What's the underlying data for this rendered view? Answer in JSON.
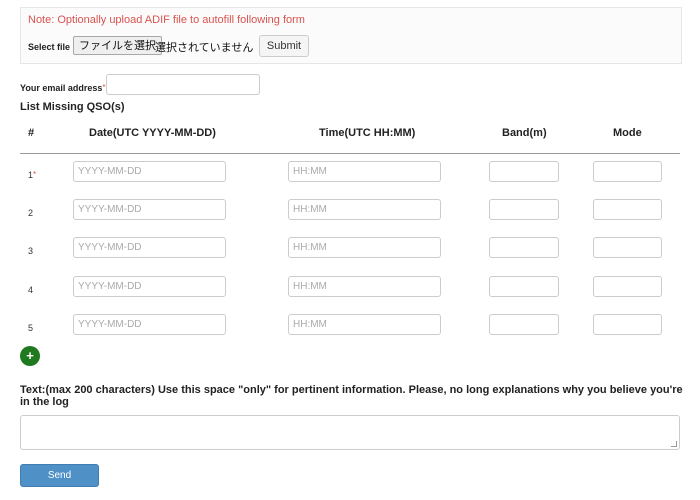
{
  "upload": {
    "note": "Note: Optionally upload ADIF file to autofill following form",
    "select_label": "Select file",
    "file_button": "ファイルを選択",
    "file_status": "選択されていません",
    "submit_label": "Submit"
  },
  "email": {
    "label": "Your email address",
    "required_mark": "*",
    "value": ""
  },
  "qso": {
    "title": "List Missing QSO(s)",
    "headers": {
      "num": "#",
      "date": "Date(UTC YYYY-MM-DD)",
      "time": "Time(UTC HH:MM)",
      "band": "Band(m)",
      "mode": "Mode"
    },
    "rows": [
      {
        "num": "1",
        "required_mark": "*",
        "date_placeholder": "YYYY-MM-DD",
        "time_placeholder": "HH:MM"
      },
      {
        "num": "2",
        "date_placeholder": "YYYY-MM-DD",
        "time_placeholder": "HH:MM"
      },
      {
        "num": "3",
        "date_placeholder": "YYYY-MM-DD",
        "time_placeholder": "HH:MM"
      },
      {
        "num": "4",
        "date_placeholder": "YYYY-MM-DD",
        "time_placeholder": "HH:MM"
      },
      {
        "num": "5",
        "date_placeholder": "YYYY-MM-DD",
        "time_placeholder": "HH:MM"
      }
    ],
    "add_label": "+"
  },
  "text": {
    "label": "Text:(max 200 characters) Use this space \"only\" for pertinent information. Please, no long explanations why you believe you're in the log",
    "value": ""
  },
  "send_label": "Send",
  "colors": {
    "note_red": "#d9534f",
    "add_green": "#1f7a1f",
    "send_blue": "#4f90c7"
  }
}
